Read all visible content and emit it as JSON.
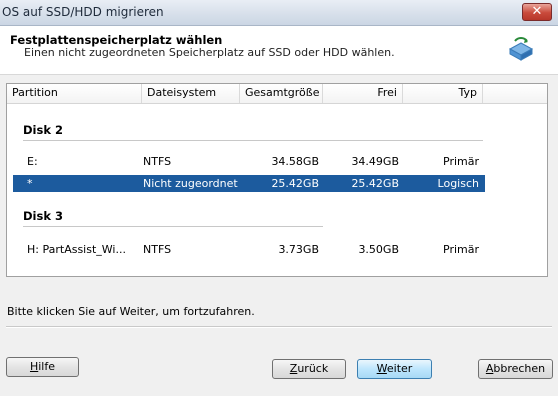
{
  "window": {
    "title": "OS auf SSD/HDD migrieren",
    "close_label": "✕"
  },
  "header": {
    "title": "Festplattenspeicherplatz wählen",
    "subtitle": "Einen nicht zugeordneten Speicherplatz auf SSD oder HDD wählen.",
    "icon": "disk-migrate-icon"
  },
  "table": {
    "columns": [
      "Partition",
      "Dateisystem",
      "Gesamtgröße",
      "Frei",
      "Typ"
    ],
    "disks": [
      {
        "label": "Disk 2",
        "rows": [
          {
            "partition": "E:",
            "filesystem": "NTFS",
            "total": "34.58GB",
            "free": "34.49GB",
            "type": "Primär",
            "selected": false
          },
          {
            "partition": "*",
            "filesystem": "Nicht zugeordnet",
            "total": "25.42GB",
            "free": "25.42GB",
            "type": "Logisch",
            "selected": true
          }
        ]
      },
      {
        "label": "Disk 3",
        "rows": [
          {
            "partition": "H:  PartAssist_Wi...",
            "filesystem": "NTFS",
            "total": "3.73GB",
            "free": "3.50GB",
            "type": "Primär",
            "selected": false
          }
        ]
      }
    ]
  },
  "status_text": "Bitte klicken Sie auf Weiter, um fortzufahren.",
  "buttons": {
    "help": {
      "mnemonic": "H",
      "rest": "ilfe"
    },
    "back": {
      "mnemonic": "Z",
      "rest": "urück"
    },
    "next": {
      "mnemonic": "W",
      "rest": "eiter"
    },
    "cancel": {
      "mnemonic": "A",
      "rest": "bbrechen"
    }
  },
  "colors": {
    "selection": "#1c5b9e",
    "title_bg": "#d6dfea",
    "close": "#c94a3b"
  }
}
